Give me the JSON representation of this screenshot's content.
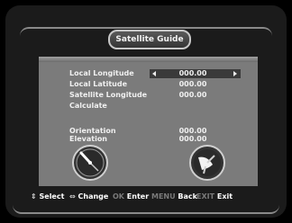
{
  "title": "Satellite Guide",
  "fields": [
    {
      "label": "Local Longitude",
      "value": "000.00"
    },
    {
      "label": "Local Latitude",
      "value": "000.00"
    },
    {
      "label": "Satellite Longitude",
      "value": "000.00"
    },
    {
      "label": "Calculate",
      "value": ""
    }
  ],
  "results": [
    {
      "label": "Orientation",
      "value": "000.00"
    },
    {
      "label": "Elevation",
      "value": "000.00"
    }
  ],
  "footer": {
    "select_label": "Select",
    "change_label": "Change",
    "ok_key": "OK",
    "enter_label": "Enter",
    "menu_key": "MENU",
    "back_label": "Back",
    "exit_key": "EXIT",
    "exit_label": "Exit"
  },
  "colors": {
    "panel": "#7b7b7b",
    "highlight": "#3a3a3a",
    "dim_key": "#7a7a7a",
    "text": "#f0f0f0"
  },
  "icons": [
    "left-arrow-icon",
    "right-arrow-icon",
    "compass-icon",
    "satellite-dish-icon",
    "updown-arrow-icon",
    "leftright-arrow-icon"
  ]
}
